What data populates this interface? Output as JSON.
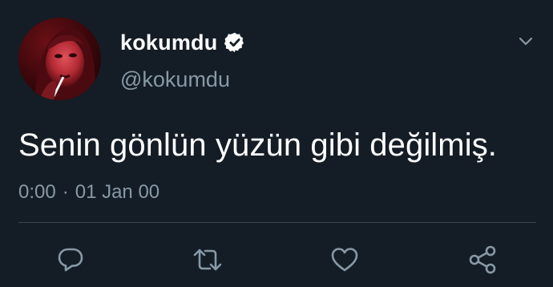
{
  "user": {
    "display_name": "kokumdu",
    "handle": "@kokumdu",
    "verified": true
  },
  "tweet": {
    "text": "Senin gönlün yüzün gibi değilmiş.",
    "time": "0:00",
    "separator": "·",
    "date": "01 Jan 00"
  },
  "icons": {
    "menu": "chevron-down-icon",
    "reply": "reply-icon",
    "retweet": "retweet-icon",
    "like": "heart-icon",
    "share": "share-icon"
  },
  "colors": {
    "background": "#141d26",
    "primary_text": "#ffffff",
    "secondary_text": "#8899a6",
    "divider": "#38444d",
    "icon": "#8899a6"
  }
}
